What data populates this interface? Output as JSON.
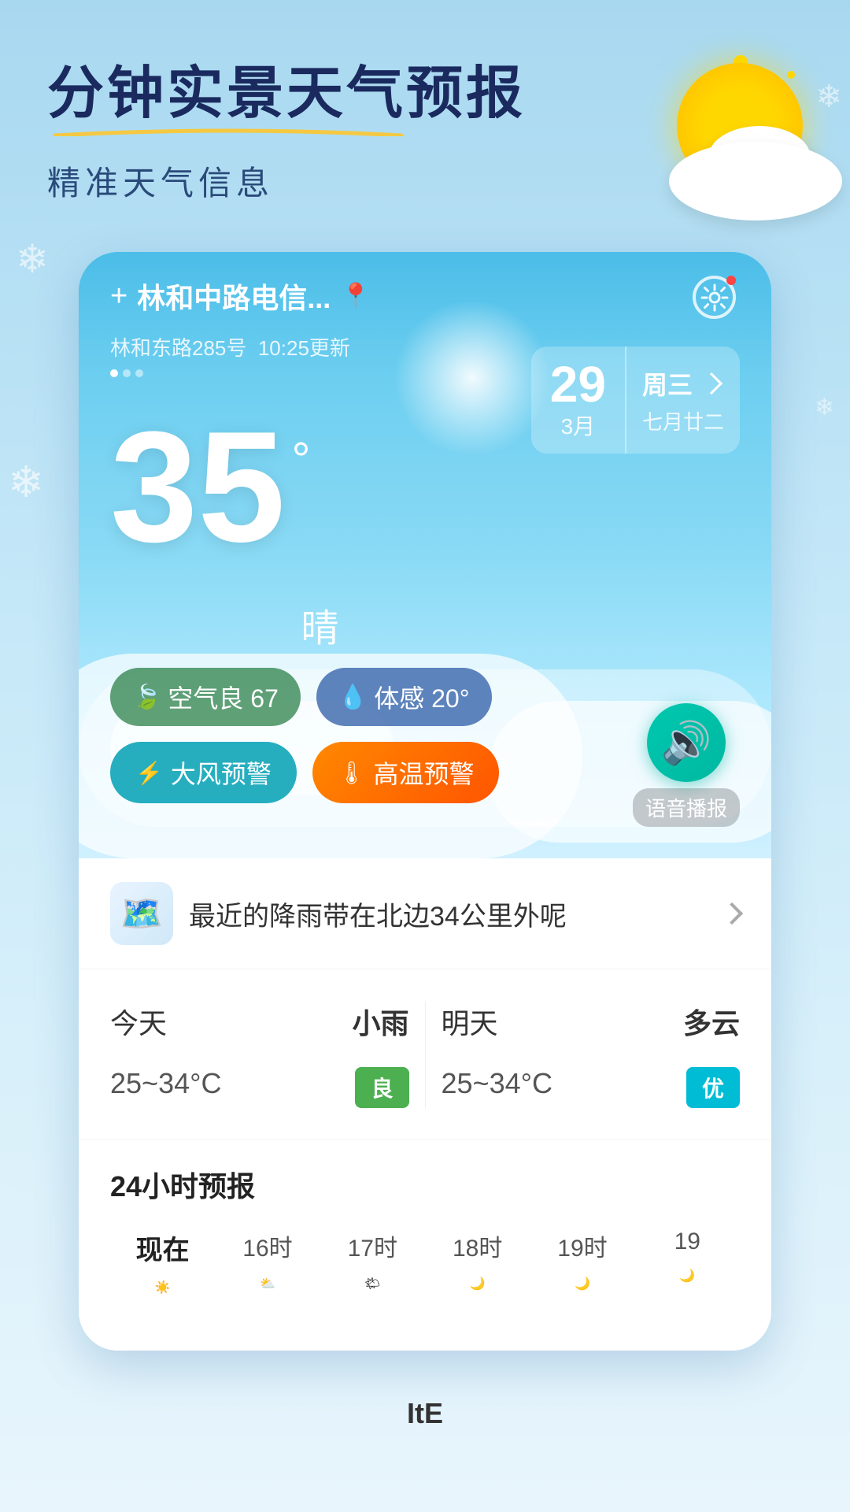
{
  "app": {
    "title": "分钟实景天气预报",
    "subtitle": "精准天气信息"
  },
  "location": {
    "name": "林和中路电信...",
    "sub_address": "林和东路285号",
    "update_time": "10:25更新",
    "plus_icon": "+",
    "pin_icon": "📍"
  },
  "weather": {
    "temperature": "35",
    "degree_symbol": "°",
    "description": "晴",
    "date": {
      "day": "29",
      "month": "3月",
      "weekday": "周三",
      "lunar": "七月廿二"
    },
    "air_quality": {
      "label": "空气良",
      "value": "67",
      "icon": "🌿"
    },
    "feel_temp": {
      "label": "体感",
      "value": "20°",
      "icon": "💧"
    },
    "warnings": {
      "wind": "大风预警",
      "heat": "高温预警"
    },
    "voice_broadcast": "语音播报"
  },
  "rain_info": {
    "text": "最近的降雨带在北边34公里外呢",
    "map_icon": "🗺️"
  },
  "forecast": {
    "today": {
      "label": "今天",
      "desc": "小雨",
      "temp": "25~34°C",
      "quality": "良",
      "quality_type": "good"
    },
    "tomorrow": {
      "label": "明天",
      "desc": "多云",
      "temp": "25~34°C",
      "quality": "优",
      "quality_type": "excellent"
    }
  },
  "hours": {
    "title": "24小时预报",
    "items": [
      {
        "label": "现在",
        "is_current": true
      },
      {
        "label": "16时",
        "is_current": false
      },
      {
        "label": "17时",
        "is_current": false
      },
      {
        "label": "18时",
        "is_current": false
      },
      {
        "label": "19时",
        "is_current": false
      },
      {
        "label": "19",
        "is_current": false
      }
    ]
  },
  "bottom_nav": {
    "label": "ItE"
  },
  "icons": {
    "gear": "⚙",
    "speaker": "🔊",
    "wind_warning": "⚠",
    "heat_warning": "🌡",
    "chevron": "▶"
  }
}
